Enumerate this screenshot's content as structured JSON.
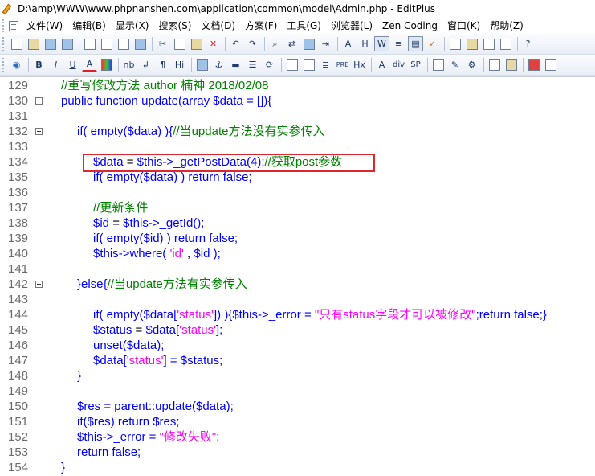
{
  "window": {
    "title": "D:\\amp\\WWW\\www.phpnanshen.com\\application\\common\\model\\Admin.php - EditPlus"
  },
  "menu": {
    "items": [
      "文件(W)",
      "编辑(B)",
      "显示(X)",
      "搜索(S)",
      "文档(D)",
      "方案(F)",
      "工具(G)",
      "浏览器(L)",
      "Zen Coding",
      "窗口(K)",
      "帮助(Z)"
    ]
  },
  "toolbar2": {
    "labels": [
      "B",
      "I",
      "U",
      "A",
      "nb",
      "↲",
      "¶",
      "Hi",
      "PRE",
      "A",
      "div",
      "SP",
      "Hx"
    ]
  },
  "editor": {
    "lines": [
      {
        "n": "129",
        "fold": false,
        "indent": 0,
        "tokens": [
          {
            "t": "//重写修改方法 author 楠神 2018/02/08",
            "c": "comment"
          }
        ]
      },
      {
        "n": "130",
        "fold": true,
        "indent": 0,
        "tokens": [
          {
            "t": "public function update(array ",
            "c": "kw"
          },
          {
            "t": "$data",
            "c": "var"
          },
          {
            "t": " = []){",
            "c": "kw"
          }
        ]
      },
      {
        "n": "131",
        "fold": false,
        "indent": 0,
        "tokens": []
      },
      {
        "n": "132",
        "fold": true,
        "indent": 1,
        "tokens": [
          {
            "t": "if( empty(",
            "c": "kw"
          },
          {
            "t": "$data",
            "c": "var"
          },
          {
            "t": ") ){",
            "c": "kw"
          },
          {
            "t": "//当update方法没有实参传入",
            "c": "comment"
          }
        ]
      },
      {
        "n": "133",
        "fold": false,
        "indent": 0,
        "tokens": []
      },
      {
        "n": "134",
        "fold": false,
        "indent": 2,
        "tokens": [
          {
            "t": "$data",
            "c": "var"
          },
          {
            "t": " = ",
            "c": "plain"
          },
          {
            "t": "$this",
            "c": "var"
          },
          {
            "t": "->_getPostData(4);",
            "c": "kw"
          },
          {
            "t": "//获取post参数",
            "c": "comment"
          }
        ]
      },
      {
        "n": "135",
        "fold": false,
        "indent": 2,
        "tokens": [
          {
            "t": "if( empty(",
            "c": "kw"
          },
          {
            "t": "$data",
            "c": "var"
          },
          {
            "t": ") ) return false;",
            "c": "kw"
          }
        ]
      },
      {
        "n": "136",
        "fold": false,
        "indent": 0,
        "tokens": []
      },
      {
        "n": "137",
        "fold": false,
        "indent": 2,
        "tokens": [
          {
            "t": "//更新条件",
            "c": "comment"
          }
        ]
      },
      {
        "n": "138",
        "fold": false,
        "indent": 2,
        "tokens": [
          {
            "t": "$id",
            "c": "var"
          },
          {
            "t": " = ",
            "c": "plain"
          },
          {
            "t": "$this",
            "c": "var"
          },
          {
            "t": "->_getId();",
            "c": "kw"
          }
        ]
      },
      {
        "n": "139",
        "fold": false,
        "indent": 2,
        "tokens": [
          {
            "t": "if( empty(",
            "c": "kw"
          },
          {
            "t": "$id",
            "c": "var"
          },
          {
            "t": ") ) return false;",
            "c": "kw"
          }
        ]
      },
      {
        "n": "140",
        "fold": false,
        "indent": 2,
        "tokens": [
          {
            "t": "$this",
            "c": "var"
          },
          {
            "t": "->where( ",
            "c": "kw"
          },
          {
            "t": "'id'",
            "c": "str"
          },
          {
            "t": " , ",
            "c": "plain"
          },
          {
            "t": "$id",
            "c": "var"
          },
          {
            "t": " );",
            "c": "kw"
          }
        ]
      },
      {
        "n": "141",
        "fold": false,
        "indent": 0,
        "tokens": []
      },
      {
        "n": "142",
        "fold": true,
        "indent": 1,
        "tokens": [
          {
            "t": "}else{",
            "c": "kw"
          },
          {
            "t": "//当update方法有实参传入",
            "c": "comment"
          }
        ]
      },
      {
        "n": "143",
        "fold": false,
        "indent": 0,
        "tokens": []
      },
      {
        "n": "144",
        "fold": false,
        "indent": 2,
        "tokens": [
          {
            "t": "if( empty(",
            "c": "kw"
          },
          {
            "t": "$data",
            "c": "var"
          },
          {
            "t": "[",
            "c": "kw"
          },
          {
            "t": "'status'",
            "c": "str"
          },
          {
            "t": "]) ){",
            "c": "kw"
          },
          {
            "t": "$this",
            "c": "var"
          },
          {
            "t": "->_error = ",
            "c": "kw"
          },
          {
            "t": "\"只有status字段才可以被修改\"",
            "c": "str"
          },
          {
            "t": ";return false;}",
            "c": "kw"
          }
        ]
      },
      {
        "n": "145",
        "fold": false,
        "indent": 2,
        "tokens": [
          {
            "t": "$status",
            "c": "var"
          },
          {
            "t": " = ",
            "c": "plain"
          },
          {
            "t": "$data",
            "c": "var"
          },
          {
            "t": "[",
            "c": "kw"
          },
          {
            "t": "'status'",
            "c": "str"
          },
          {
            "t": "];",
            "c": "kw"
          }
        ]
      },
      {
        "n": "146",
        "fold": false,
        "indent": 2,
        "tokens": [
          {
            "t": "unset(",
            "c": "kw"
          },
          {
            "t": "$data",
            "c": "var"
          },
          {
            "t": ");",
            "c": "kw"
          }
        ]
      },
      {
        "n": "147",
        "fold": false,
        "indent": 2,
        "tokens": [
          {
            "t": "$data",
            "c": "var"
          },
          {
            "t": "[",
            "c": "kw"
          },
          {
            "t": "'status'",
            "c": "str"
          },
          {
            "t": "] = ",
            "c": "kw"
          },
          {
            "t": "$status",
            "c": "var"
          },
          {
            "t": ";",
            "c": "kw"
          }
        ]
      },
      {
        "n": "148",
        "fold": false,
        "indent": 1,
        "tokens": [
          {
            "t": "}",
            "c": "kw"
          }
        ]
      },
      {
        "n": "149",
        "fold": false,
        "indent": 0,
        "tokens": []
      },
      {
        "n": "150",
        "fold": false,
        "indent": 1,
        "tokens": [
          {
            "t": "$res",
            "c": "var"
          },
          {
            "t": " = parent::update(",
            "c": "kw"
          },
          {
            "t": "$data",
            "c": "var"
          },
          {
            "t": ");",
            "c": "kw"
          }
        ]
      },
      {
        "n": "151",
        "fold": false,
        "indent": 1,
        "tokens": [
          {
            "t": "if(",
            "c": "kw"
          },
          {
            "t": "$res",
            "c": "var"
          },
          {
            "t": ") return ",
            "c": "kw"
          },
          {
            "t": "$res",
            "c": "var"
          },
          {
            "t": ";",
            "c": "kw"
          }
        ]
      },
      {
        "n": "152",
        "fold": false,
        "indent": 1,
        "tokens": [
          {
            "t": "$this",
            "c": "var"
          },
          {
            "t": "->_error = ",
            "c": "kw"
          },
          {
            "t": "\"修改失败\"",
            "c": "str"
          },
          {
            "t": ";",
            "c": "kw"
          }
        ]
      },
      {
        "n": "153",
        "fold": false,
        "indent": 1,
        "tokens": [
          {
            "t": "return false;",
            "c": "kw"
          }
        ]
      },
      {
        "n": "154",
        "fold": false,
        "indent": 0,
        "tokens": [
          {
            "t": "}",
            "c": "kw"
          }
        ]
      }
    ]
  },
  "colors": {
    "comment": "#008000",
    "keyword": "#0000ff",
    "string": "#ff00ff",
    "highlight_box": "#e0262c"
  },
  "icons": {
    "toolbar1": [
      "new-file-icon",
      "open-folder-icon",
      "save-icon",
      "save-all-icon",
      "print-icon",
      "print-preview-icon",
      "spellcheck-icon",
      "cut-icon",
      "copy-icon",
      "paste-icon",
      "delete-icon",
      "undo-icon",
      "redo-icon",
      "find-icon",
      "replace-icon",
      "goto-icon",
      "word-wrap-icon",
      "check-icon"
    ],
    "toolbar2": [
      "browser-globe-icon",
      "font-color-icon",
      "color-picker-icon",
      "image-icon",
      "anchor-icon",
      "hr-icon",
      "table-icon"
    ]
  }
}
